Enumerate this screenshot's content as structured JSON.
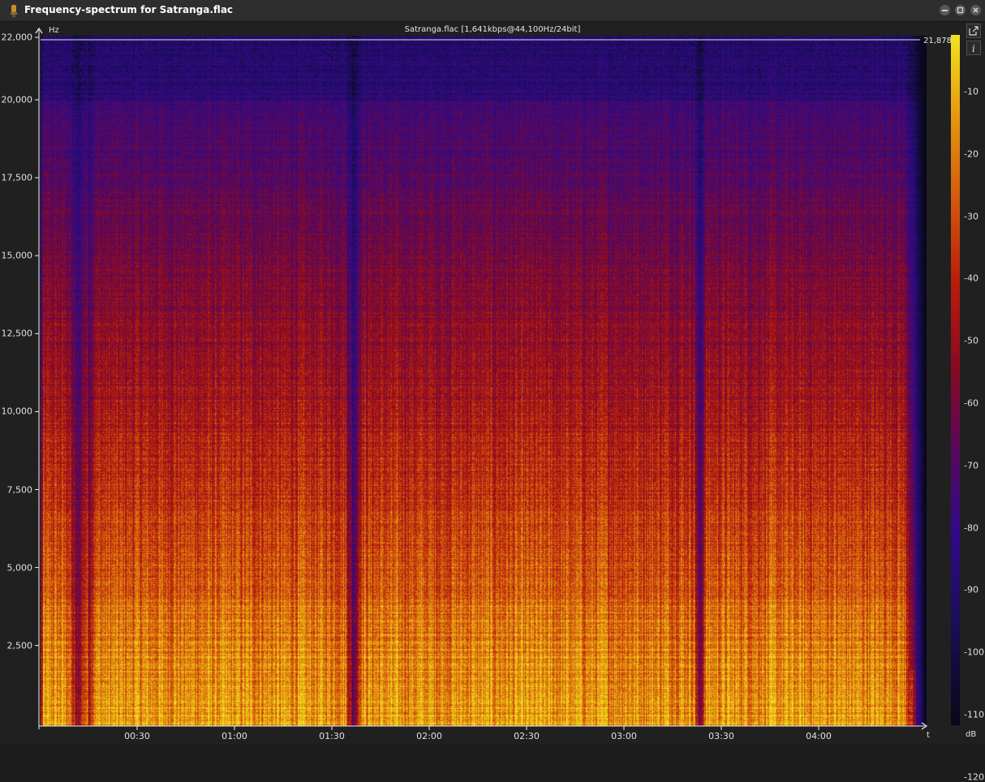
{
  "window": {
    "title": "Frequency-spectrum for Satranga.flac",
    "icon": "lamp-icon"
  },
  "plot": {
    "file_info": "Satranga.flac [1,641kbps@44,100Hz/24bit]",
    "y_unit": "Hz",
    "x_unit": "t",
    "cutoff_label": "21,878",
    "y_ticks": [
      "22,000",
      "20,000",
      "17,500",
      "15,000",
      "12,500",
      "10,000",
      "7,500",
      "5,000",
      "2,500"
    ],
    "x_ticks": [
      "00:30",
      "01:00",
      "01:30",
      "02:00",
      "02:30",
      "03:00",
      "03:30",
      "04:00"
    ]
  },
  "colorbar": {
    "unit": "dB",
    "ticks": [
      "-10",
      "-20",
      "-30",
      "-40",
      "-50",
      "-60",
      "-70",
      "-80",
      "-90",
      "-100",
      "-110",
      "-120"
    ],
    "colors": [
      "#f0e41e",
      "#e8a211",
      "#d7610d",
      "#b81d0c",
      "#8a0a22",
      "#58085a",
      "#300a8a",
      "#1c0d5c",
      "#080818"
    ]
  },
  "toolbar": {
    "buttons": [
      "export-icon",
      "info-icon"
    ]
  }
}
